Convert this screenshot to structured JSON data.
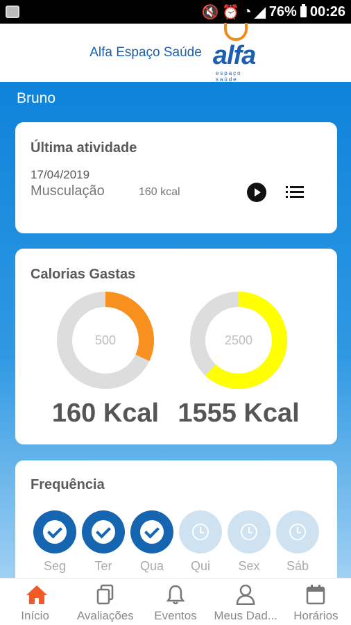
{
  "status_bar": {
    "battery": "76%",
    "time": "00:26"
  },
  "header": {
    "title": "Alfa Espaço Saúde",
    "logo_text": "alfa",
    "logo_subtext": "espaço saúde"
  },
  "user": {
    "name": "Bruno"
  },
  "last_activity": {
    "title": "Última atividade",
    "date": "17/04/2019",
    "type": "Musculação",
    "kcal": "160 kcal"
  },
  "calories": {
    "title": "Calorias Gastas",
    "daily": {
      "goal": "500",
      "value": "160 Kcal",
      "progress": 0.32,
      "color": "#f7901e"
    },
    "total": {
      "goal": "2500",
      "value": "1555 Kcal",
      "progress": 0.62,
      "color": "#ffff00"
    }
  },
  "frequency": {
    "title": "Frequência",
    "days": [
      {
        "label": "Seg",
        "status": "done"
      },
      {
        "label": "Ter",
        "status": "done"
      },
      {
        "label": "Qua",
        "status": "done"
      },
      {
        "label": "Qui",
        "status": "pending"
      },
      {
        "label": "Sex",
        "status": "pending"
      },
      {
        "label": "Sáb",
        "status": "pending"
      }
    ]
  },
  "bottom_nav": {
    "items": [
      {
        "label": "Início",
        "icon": "home-icon",
        "active": true
      },
      {
        "label": "Avaliações",
        "icon": "documents-icon",
        "active": false
      },
      {
        "label": "Eventos",
        "icon": "bell-icon",
        "active": false
      },
      {
        "label": "Meus Dad...",
        "icon": "person-icon",
        "active": false
      },
      {
        "label": "Horários",
        "icon": "calendar-icon",
        "active": false
      }
    ]
  },
  "colors": {
    "primary": "#1b5fae",
    "accent": "#f05a28",
    "day_done": "#1565b0",
    "day_pending": "#cfe2f2"
  }
}
